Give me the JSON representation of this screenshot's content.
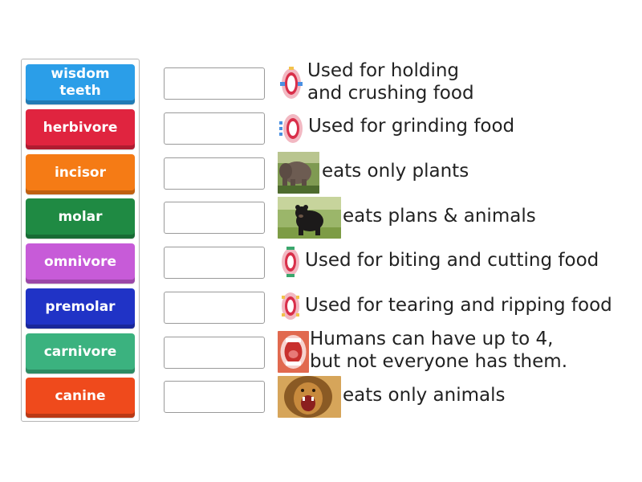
{
  "tiles": [
    {
      "label": "wisdom teeth",
      "color": "#2b9ee8"
    },
    {
      "label": "herbivore",
      "color": "#e0243f"
    },
    {
      "label": "incisor",
      "color": "#f57b15"
    },
    {
      "label": "molar",
      "color": "#1f8a43"
    },
    {
      "label": "omnivore",
      "color": "#c75bd8"
    },
    {
      "label": "premolar",
      "color": "#2033c6"
    },
    {
      "label": "carnivore",
      "color": "#3bb27f"
    },
    {
      "label": "canine",
      "color": "#ef4a1c"
    }
  ],
  "clues": [
    {
      "text_line1": "Used for holding",
      "text_line2": "and crushing food",
      "icon": "teeth-diagram-icon"
    },
    {
      "text_line1": "Used for grinding food",
      "icon": "teeth-diagram-icon"
    },
    {
      "text_line1": "eats only plants",
      "icon": "elephant-photo"
    },
    {
      "text_line1": "eats plans & animals",
      "icon": "bear-photo"
    },
    {
      "text_line1": "Used for biting and cutting food",
      "icon": "teeth-diagram-icon"
    },
    {
      "text_line1": "Used for tearing and ripping food",
      "icon": "teeth-diagram-icon"
    },
    {
      "text_line1": "Humans can have up to 4,",
      "text_line2": "but not everyone has them.",
      "icon": "open-mouth-photo"
    },
    {
      "text_line1": "eats only animals",
      "icon": "lion-photo"
    }
  ]
}
